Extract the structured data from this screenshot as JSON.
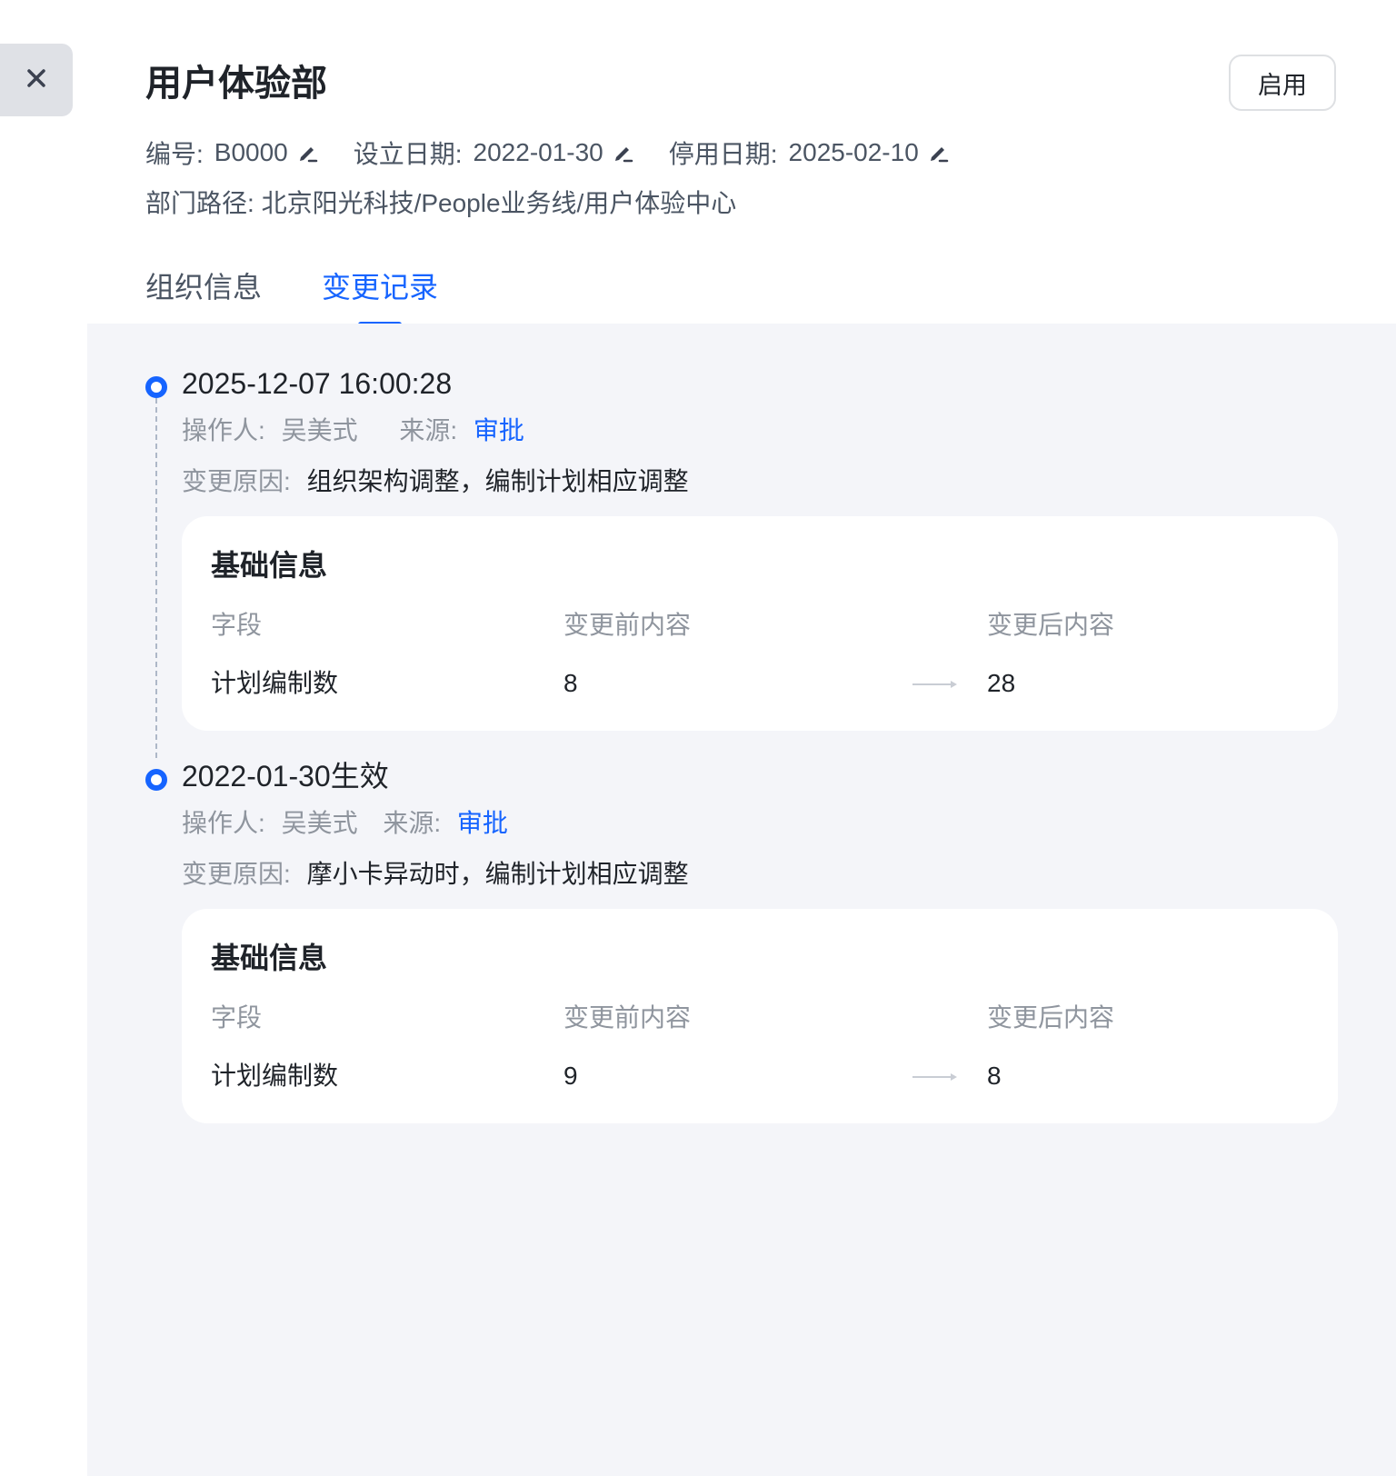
{
  "icons": {
    "close": "close-icon",
    "edit": "pencil-icon",
    "arrow": "arrow-right-icon"
  },
  "colors": {
    "accent": "#1664ff",
    "panel_bg": "#f4f5f9"
  },
  "header": {
    "title": "用户体验部",
    "enable_label": "启用",
    "code_label": "编号:",
    "code_value": "B0000",
    "established_label": "设立日期:",
    "established_value": "2022-01-30",
    "disabled_label": "停用日期:",
    "disabled_value": "2025-02-10",
    "path_label": "部门路径:",
    "path_value": "北京阳光科技/People业务线/用户体验中心"
  },
  "tabs": [
    {
      "label": "组织信息",
      "active": false
    },
    {
      "label": "变更记录",
      "active": true
    }
  ],
  "records": [
    {
      "time": "2025-12-07 16:00:28",
      "operator_label": "操作人:",
      "operator": "吴美式",
      "source_label": "来源:",
      "source": "审批",
      "reason_label": "变更原因:",
      "reason": "组织架构调整，编制计划相应调整",
      "card": {
        "title": "基础信息",
        "headers": {
          "field": "字段",
          "before": "变更前内容",
          "after": "变更后内容"
        },
        "rows": [
          {
            "field": "计划编制数",
            "before": "8",
            "after": "28"
          }
        ]
      }
    },
    {
      "time": "2022-01-30生效",
      "operator_label": "操作人:",
      "operator": "吴美式",
      "source_label": "来源:",
      "source": "审批",
      "reason_label": "变更原因:",
      "reason": "摩小卡异动时，编制计划相应调整",
      "card": {
        "title": "基础信息",
        "headers": {
          "field": "字段",
          "before": "变更前内容",
          "after": "变更后内容"
        },
        "rows": [
          {
            "field": "计划编制数",
            "before": "9",
            "after": "8"
          }
        ]
      }
    }
  ]
}
